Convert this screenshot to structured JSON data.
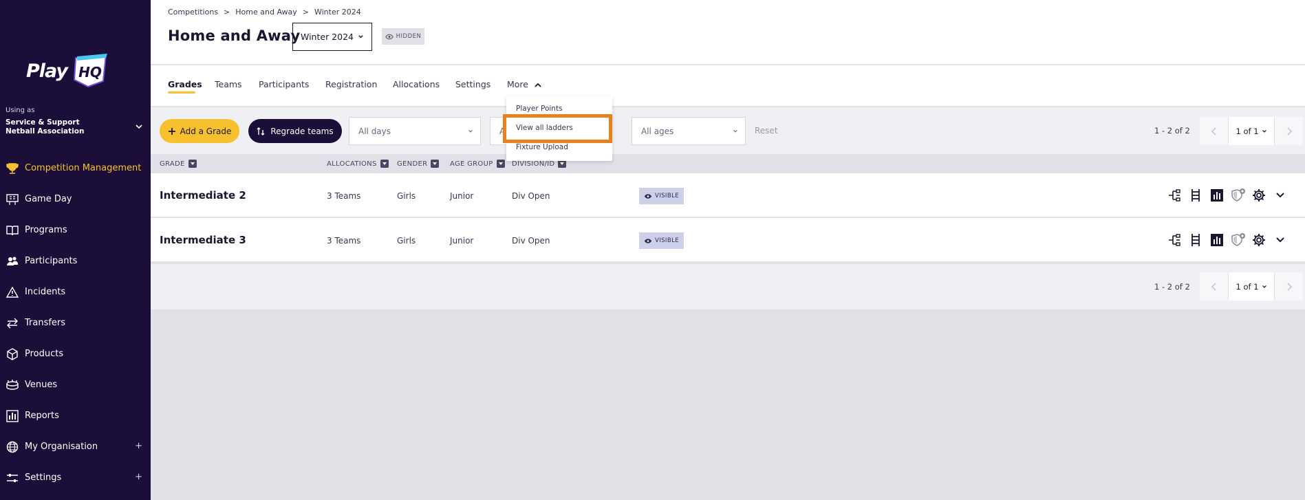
{
  "sidebar": {
    "logo_text": "Play",
    "logo_hq": "HQ",
    "using_as": "Using as",
    "org_name": "Service & Support Netball Association",
    "items": [
      {
        "label": "Competition Management",
        "icon": "trophy-icon",
        "active": true
      },
      {
        "label": "Game Day",
        "icon": "scoreboard-icon"
      },
      {
        "label": "Programs",
        "icon": "book-icon"
      },
      {
        "label": "Participants",
        "icon": "people-icon"
      },
      {
        "label": "Incidents",
        "icon": "warning-icon"
      },
      {
        "label": "Transfers",
        "icon": "transfer-arrows-icon"
      },
      {
        "label": "Products",
        "icon": "box-icon"
      },
      {
        "label": "Venues",
        "icon": "stadium-icon"
      },
      {
        "label": "Reports",
        "icon": "report-chart-icon"
      },
      {
        "label": "My Organisation",
        "icon": "globe-icon",
        "expandable": "+"
      },
      {
        "label": "Settings",
        "icon": "sliders-icon",
        "expandable": "+"
      }
    ]
  },
  "header": {
    "breadcrumb": [
      "Competitions",
      "Home and Away",
      "Winter 2024"
    ],
    "title": "Home and Away",
    "season": "Winter 2024",
    "status_badge": "HIDDEN"
  },
  "tabs": [
    "Grades",
    "Teams",
    "Participants",
    "Registration",
    "Allocations",
    "Settings",
    "More"
  ],
  "more_menu": [
    "Player Points",
    "View all ladders",
    "Fixture Upload"
  ],
  "toolbar": {
    "add_grade": "Add a Grade",
    "regrade": "Regrade teams",
    "filters": {
      "days": "All days",
      "filter2": "A",
      "ages": "All ages"
    },
    "reset": "Reset",
    "count": "1 - 2 of 2",
    "page": "1 of 1"
  },
  "columns": [
    "GRADE",
    "ALLOCATIONS",
    "GENDER",
    "AGE GROUP",
    "DIVISION/ID"
  ],
  "rows": [
    {
      "grade": "Intermediate 2",
      "allocations": "3 Teams",
      "gender": "Girls",
      "age_group": "Junior",
      "division": "Div Open",
      "status": "VISIBLE"
    },
    {
      "grade": "Intermediate 3",
      "allocations": "3 Teams",
      "gender": "Girls",
      "age_group": "Junior",
      "division": "Div Open",
      "status": "VISIBLE"
    }
  ],
  "footer": {
    "count": "1 - 2 of 2",
    "page": "1 of 1"
  },
  "colors": {
    "sidebar_bg": "#1b0f3a",
    "accent_yellow": "#f7c02e",
    "highlight_orange": "#e8821e"
  }
}
